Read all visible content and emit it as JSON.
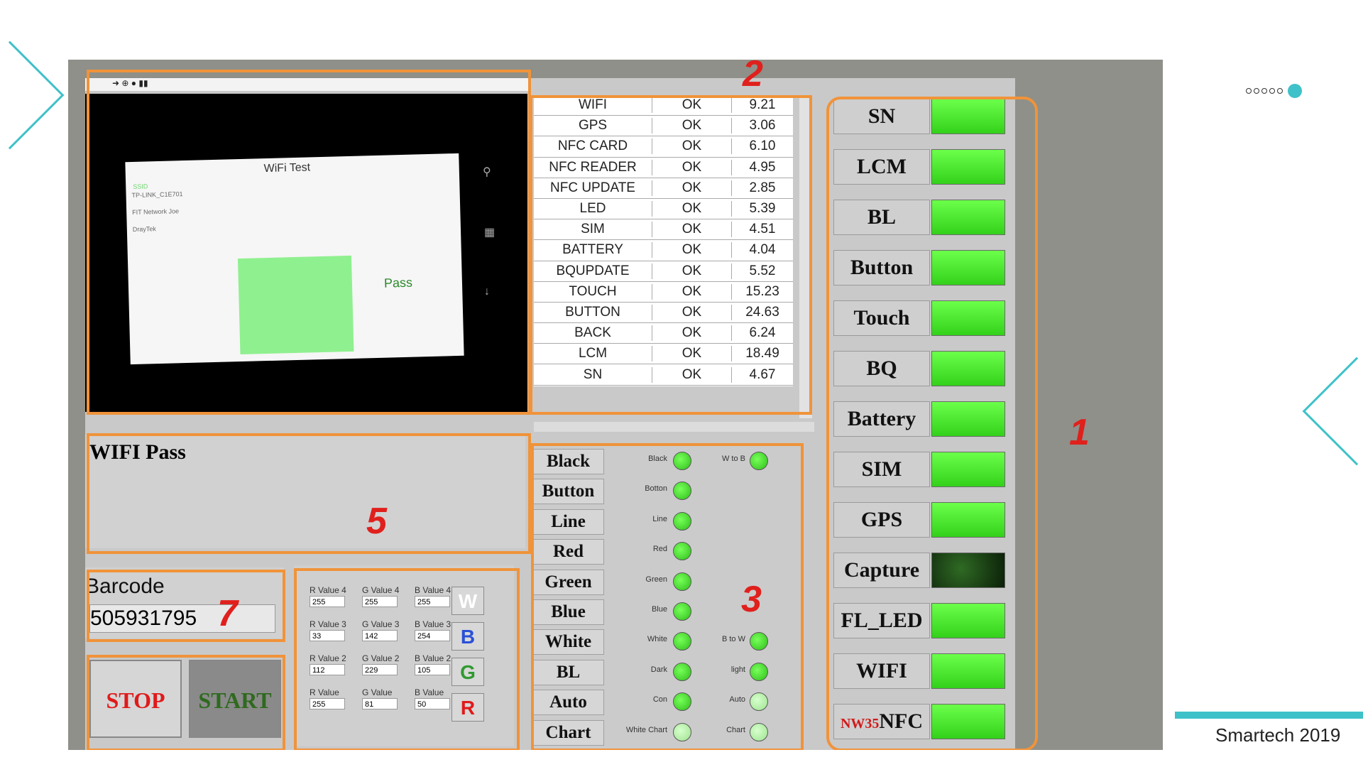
{
  "slide": {
    "footer_text": "Smartech 2019",
    "accent_color": "#3fc1c9"
  },
  "markers": [
    "1",
    "2",
    "3",
    "5",
    "7"
  ],
  "camera": {
    "screen_title": "WiFi Test",
    "pass_text": "Pass"
  },
  "results_table": {
    "rows": [
      {
        "item": "WIFI",
        "state": "OK",
        "time": "9.21"
      },
      {
        "item": "GPS",
        "state": "OK",
        "time": "3.06"
      },
      {
        "item": "NFC CARD",
        "state": "OK",
        "time": "6.10"
      },
      {
        "item": "NFC READER",
        "state": "OK",
        "time": "4.95"
      },
      {
        "item": "NFC UPDATE",
        "state": "OK",
        "time": "2.85"
      },
      {
        "item": "LED",
        "state": "OK",
        "time": "5.39"
      },
      {
        "item": "SIM",
        "state": "OK",
        "time": "4.51"
      },
      {
        "item": "BATTERY",
        "state": "OK",
        "time": "4.04"
      },
      {
        "item": "BQUPDATE",
        "state": "OK",
        "time": "5.52"
      },
      {
        "item": "TOUCH",
        "state": "OK",
        "time": "15.23"
      },
      {
        "item": "BUTTON",
        "state": "OK",
        "time": "24.63"
      },
      {
        "item": "BACK",
        "state": "OK",
        "time": "6.24"
      },
      {
        "item": "LCM",
        "state": "OK",
        "time": "18.49"
      },
      {
        "item": "SN",
        "state": "OK",
        "time": "4.67"
      }
    ]
  },
  "test_buttons": [
    {
      "label": "SN"
    },
    {
      "label": "LCM"
    },
    {
      "label": "BL"
    },
    {
      "label": "Button"
    },
    {
      "label": "Touch"
    },
    {
      "label": "BQ"
    },
    {
      "label": "Battery"
    },
    {
      "label": "SIM"
    },
    {
      "label": "GPS"
    },
    {
      "label": "Capture",
      "led": "dark"
    },
    {
      "label": "FL_LED"
    },
    {
      "label": "WIFI"
    },
    {
      "label": "NFC",
      "prefix": "NW35"
    }
  ],
  "message": {
    "text": "WIFI Pass"
  },
  "barcode": {
    "label": "Barcode",
    "value": "505931795"
  },
  "controls": {
    "stop_label": "STOP",
    "start_label": "START"
  },
  "rgb_values": {
    "rows": [
      {
        "labels": [
          "R Value 4",
          "G Value 4",
          "B Value 4"
        ],
        "values": [
          "255",
          "255",
          "255"
        ]
      },
      {
        "labels": [
          "R Value 3",
          "G Value 3",
          "B Value 3"
        ],
        "values": [
          "33",
          "142",
          "254"
        ]
      },
      {
        "labels": [
          "R Value 2",
          "G Value 2",
          "B Value 2"
        ],
        "values": [
          "112",
          "229",
          "105"
        ]
      },
      {
        "labels": [
          "R Value",
          "G Value",
          "B Value"
        ],
        "values": [
          "255",
          "81",
          "50"
        ]
      }
    ],
    "letter_buttons": [
      "W",
      "B",
      "G",
      "R"
    ]
  },
  "checks": {
    "buttons": [
      "Black",
      "Button",
      "Line",
      "Red",
      "Green",
      "Blue",
      "White",
      "BL",
      "Auto",
      "Chart"
    ],
    "left_leds": [
      "Black",
      "Botton",
      "Line",
      "Red",
      "Green",
      "Blue",
      "White",
      "Dark",
      "Con",
      "White Chart"
    ],
    "right_leds": [
      {
        "label": "W to B",
        "row": 0
      },
      {
        "label": "B to W",
        "row": 6
      },
      {
        "label": "light",
        "row": 7
      },
      {
        "label": "Auto",
        "row": 8
      },
      {
        "label": "Chart",
        "row": 9
      }
    ]
  }
}
